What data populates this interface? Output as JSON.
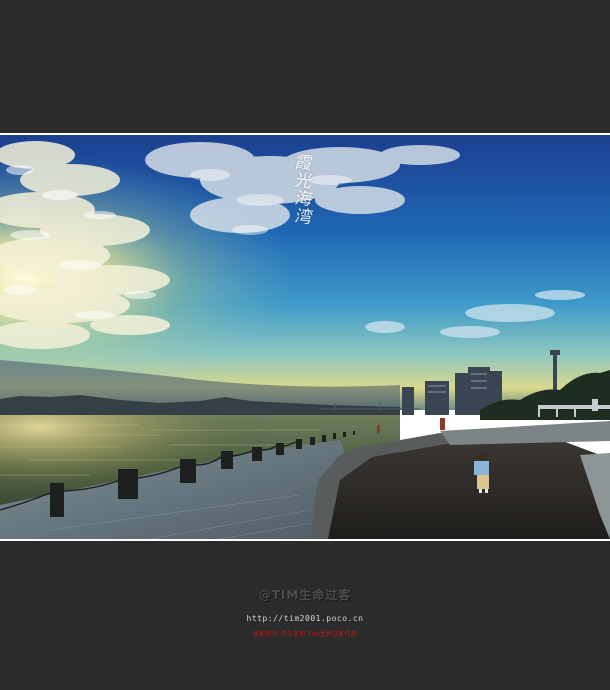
{
  "photo": {
    "vertical_title": "霞光海湾"
  },
  "footer": {
    "logo_text": "@TIM生命过客",
    "url": "http://tim2001.poco.cn",
    "note": "版权所有 请勿盗用 TIM生命过客作品"
  },
  "colors": {
    "background": "#2b2b2b",
    "frame_border": "#ffffff",
    "sky_top": "#1b4a9c",
    "horizon_glow": "#f2e48a",
    "water": "#3d5a45",
    "note_red": "#b51e1e"
  }
}
